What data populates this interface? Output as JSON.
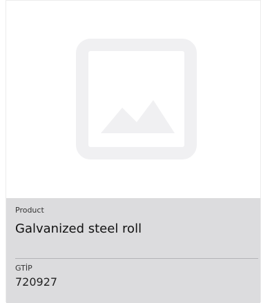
{
  "card": {
    "image": {
      "icon": "image-placeholder-icon",
      "colors": {
        "frame": "#f0f0f2",
        "mountains": "#f0f0f2"
      }
    },
    "product": {
      "label": "Product",
      "name": "Galvanized steel roll"
    },
    "gtip": {
      "label": "GTİP",
      "code": "720927"
    },
    "colors": {
      "info_bg": "#dcdcde"
    }
  }
}
